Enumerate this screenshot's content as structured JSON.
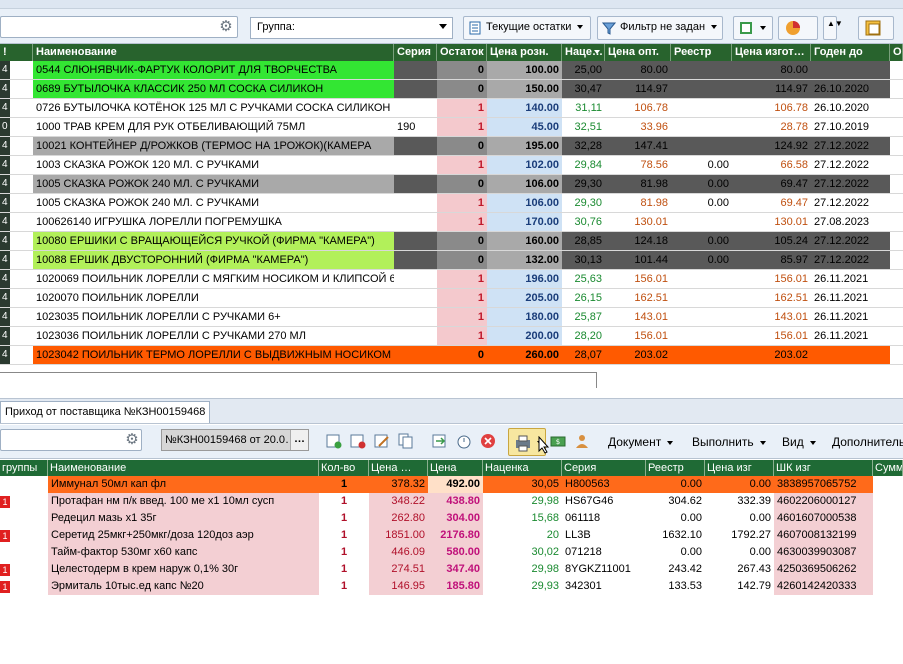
{
  "toolbar": {
    "group_combo": "Группа:",
    "current_stock_btn": "Текущие остатки",
    "filter_btn": "Фильтр не задан"
  },
  "grid1": {
    "headers": [
      "!",
      "Наименование",
      "Серия",
      "Остаток",
      "Цена розн.",
      "Наце…",
      "Цена опт.",
      "Реестр",
      "Цена изгот…",
      "Годен до",
      "О"
    ],
    "rows": [
      {
        "ind": "4",
        "name": "0544 СЛЮНЯВЧИК-ФАРТУК КОЛОРИТ ДЛЯ ТВОРЧЕСТВА",
        "series": "",
        "stock": "0",
        "retail": "100.00",
        "markup": "25,00",
        "opt": "80.00",
        "reestr": "",
        "mfr": "80.00",
        "expiry": "",
        "style": "green"
      },
      {
        "ind": "4",
        "name": "0689 БУТЫЛОЧКА КЛАССИК 250 МЛ СОСКА СИЛИКОН",
        "series": "",
        "stock": "0",
        "retail": "150.00",
        "markup": "30,47",
        "opt": "114.97",
        "reestr": "",
        "mfr": "114.97",
        "expiry": "26.10.2020",
        "style": "green"
      },
      {
        "ind": "4",
        "name": "0726 БУТЫЛОЧКА КОТЁНОК 125 МЛ С РУЧКАМИ СОСКА СИЛИКОН",
        "series": "",
        "stock": "1",
        "retail": "140.00",
        "markup": "31,11",
        "opt": "106.78",
        "reestr": "",
        "mfr": "106.78",
        "expiry": "26.10.2020",
        "style": "white"
      },
      {
        "ind": "0",
        "name": "1000 ТРАВ КРЕМ ДЛЯ РУК ОТБЕЛИВАЮЩИЙ 75МЛ",
        "series": "190",
        "stock": "1",
        "retail": "45.00",
        "markup": "32,51",
        "opt": "33.96",
        "reestr": "",
        "mfr": "28.78",
        "expiry": "27.10.2019",
        "style": "white"
      },
      {
        "ind": "4",
        "name": "10021 КОНТЕЙНЕР Д/РОЖКОВ (ТЕРМОС НА 1РОЖОК)(КАМЕРА",
        "series": "",
        "stock": "0",
        "retail": "195.00",
        "markup": "32,28",
        "opt": "147.41",
        "reestr": "",
        "mfr": "124.92",
        "expiry": "27.12.2022",
        "style": "gray"
      },
      {
        "ind": "4",
        "name": "1003 СКАЗКА РОЖОК 120 МЛ. С РУЧКАМИ",
        "series": "",
        "stock": "1",
        "retail": "102.00",
        "markup": "29,84",
        "opt": "78.56",
        "reestr": "0.00",
        "mfr": "66.58",
        "expiry": "27.12.2022",
        "style": "white"
      },
      {
        "ind": "4",
        "name": "1005 СКАЗКА РОЖОК 240 МЛ. С РУЧКАМИ",
        "series": "",
        "stock": "0",
        "retail": "106.00",
        "markup": "29,30",
        "opt": "81.98",
        "reestr": "0.00",
        "mfr": "69.47",
        "expiry": "27.12.2022",
        "style": "gray"
      },
      {
        "ind": "4",
        "name": "1005 СКАЗКА РОЖОК 240 МЛ. С РУЧКАМИ",
        "series": "",
        "stock": "1",
        "retail": "106.00",
        "markup": "29,30",
        "opt": "81.98",
        "reestr": "0.00",
        "mfr": "69.47",
        "expiry": "27.12.2022",
        "style": "white"
      },
      {
        "ind": "4",
        "name": "100626140 ИГРУШКА ЛОРЕЛЛИ ПОГРЕМУШКА",
        "series": "",
        "stock": "1",
        "retail": "170.00",
        "markup": "30,76",
        "opt": "130.01",
        "reestr": "",
        "mfr": "130.01",
        "expiry": "27.08.2023",
        "style": "white"
      },
      {
        "ind": "4",
        "name": "10080 ЕРШИКИ С ВРАЩАЮЩЕЙСЯ РУЧКОЙ (ФИРМА \"КАМЕРА\")",
        "series": "",
        "stock": "0",
        "retail": "160.00",
        "markup": "28,85",
        "opt": "124.18",
        "reestr": "0.00",
        "mfr": "105.24",
        "expiry": "27.12.2022",
        "style": "lime"
      },
      {
        "ind": "4",
        "name": "10088 ЕРШИК ДВУСТОРОННИЙ (ФИРМА \"КАМЕРА\")",
        "series": "",
        "stock": "0",
        "retail": "132.00",
        "markup": "30,13",
        "opt": "101.44",
        "reestr": "0.00",
        "mfr": "85.97",
        "expiry": "27.12.2022",
        "style": "lime"
      },
      {
        "ind": "4",
        "name": "1020069 ПОИЛЬНИК ЛОРЕЛЛИ С МЯГКИМ НОСИКОМ И КЛИПСОЙ 6+",
        "series": "",
        "stock": "1",
        "retail": "196.00",
        "markup": "25,63",
        "opt": "156.01",
        "reestr": "",
        "mfr": "156.01",
        "expiry": "26.11.2021",
        "style": "white"
      },
      {
        "ind": "4",
        "name": "1020070 ПОИЛЬНИК ЛОРЕЛЛИ",
        "series": "",
        "stock": "1",
        "retail": "205.00",
        "markup": "26,15",
        "opt": "162.51",
        "reestr": "",
        "mfr": "162.51",
        "expiry": "26.11.2021",
        "style": "white"
      },
      {
        "ind": "4",
        "name": "1023035 ПОИЛЬНИК ЛОРЕЛЛИ С РУЧКАМИ 6+",
        "series": "",
        "stock": "1",
        "retail": "180.00",
        "markup": "25,87",
        "opt": "143.01",
        "reestr": "",
        "mfr": "143.01",
        "expiry": "26.11.2021",
        "style": "white"
      },
      {
        "ind": "4",
        "name": "1023036 ПОИЛЬНИК ЛОРЕЛЛИ С РУЧКАМИ 270 МЛ",
        "series": "",
        "stock": "1",
        "retail": "200.00",
        "markup": "28,20",
        "opt": "156.01",
        "reestr": "",
        "mfr": "156.01",
        "expiry": "26.11.2021",
        "style": "white"
      },
      {
        "ind": "4",
        "name": "1023042 ПОИЛЬНИК ТЕРМО ЛОРЕЛЛИ С ВЫДВИЖНЫМ НОСИКОМ И",
        "series": "",
        "stock": "0",
        "retail": "260.00",
        "markup": "28,07",
        "opt": "203.02",
        "reestr": "",
        "mfr": "203.02",
        "expiry": "",
        "style": "orange"
      }
    ]
  },
  "tab": {
    "label": "Приход от поставщика №КЗН00159468"
  },
  "toolbar2": {
    "doc_number": "№КЗН00159468 от 20.0…",
    "doc_dots": "…",
    "document_menu": "Документ",
    "execute_menu": "Выполнить",
    "view_menu": "Вид",
    "more_menu": "Дополнитель"
  },
  "grid2": {
    "headers": [
      "группы",
      "Наименование",
      "Кол-во",
      "Цена …",
      "Цена",
      "Наценка",
      "Серия",
      "Реестр",
      "Цена изг",
      "ШК изг",
      "Сумм"
    ],
    "rows": [
      {
        "mark": "",
        "name": "Иммунал 50мл кап фл",
        "qty": "1",
        "price_in": "378.32",
        "price": "492.00",
        "markup": "30,05",
        "series": "H800563",
        "reestr": "0.00",
        "mfr": "0.00",
        "barcode": "3838957065752",
        "selected": true
      },
      {
        "mark": "1",
        "name": "Протафан нм п/к введ. 100 ме х1 10мл сусп",
        "qty": "1",
        "price_in": "348.22",
        "price": "438.80",
        "markup": "29,98",
        "series": "HS67G46",
        "reestr": "304.62",
        "mfr": "332.39",
        "barcode": "4602206000127",
        "selected": false
      },
      {
        "mark": "",
        "name": "Редецил мазь х1 35г",
        "qty": "1",
        "price_in": "262.80",
        "price": "304.00",
        "markup": "15,68",
        "series": "061118",
        "reestr": "0.00",
        "mfr": "0.00",
        "barcode": "4601607000538",
        "selected": false
      },
      {
        "mark": "1",
        "name": "Серетид 25мкг+250мкг/доза 120доз аэр",
        "qty": "1",
        "price_in": "1851.00",
        "price": "2176.80",
        "markup": "20",
        "series": "LL3B",
        "reestr": "1632.10",
        "mfr": "1792.27",
        "barcode": "4607008132199",
        "selected": false
      },
      {
        "mark": "",
        "name": "Тайм-фактор 530мг х60 капс",
        "qty": "1",
        "price_in": "446.09",
        "price": "580.00",
        "markup": "30,02",
        "series": "071218",
        "reestr": "0.00",
        "mfr": "0.00",
        "barcode": "4630039903087",
        "selected": false
      },
      {
        "mark": "1",
        "name": "Целестодерм в крем наруж 0,1% 30г",
        "qty": "1",
        "price_in": "274.51",
        "price": "347.40",
        "markup": "29,98",
        "series": "8YGKZ11001",
        "reestr": "243.42",
        "mfr": "267.43",
        "barcode": "4250369506262",
        "selected": false
      },
      {
        "mark": "1",
        "name": "Эрмиталь 10тыс.ед капс №20",
        "qty": "1",
        "price_in": "146.95",
        "price": "185.80",
        "markup": "29,93",
        "series": "342301",
        "reestr": "133.53",
        "mfr": "142.79",
        "barcode": "4260142420333",
        "selected": false
      }
    ]
  },
  "colors": {
    "header_green": "#28632d",
    "row_green": "#33e633",
    "row_lime": "#b2f05a",
    "row_gray": "#a9a9a9",
    "row_orange": "#ff5a00",
    "selection_dark": "#595959",
    "grid2_selected": "#ff6a1a",
    "grid2_pink": "#f3cfd3"
  }
}
